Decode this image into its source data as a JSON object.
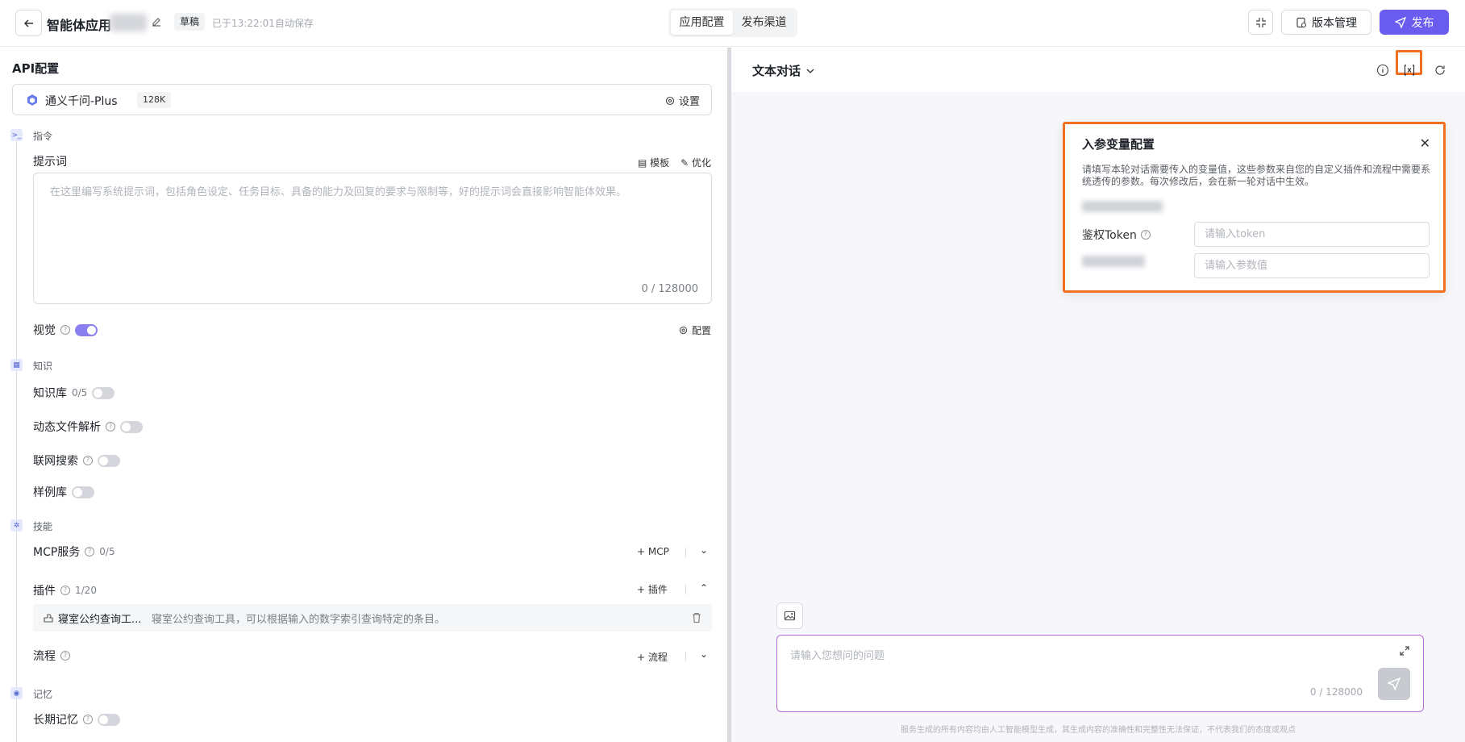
{
  "header": {
    "title": "智能体应用",
    "draft_badge": "草稿",
    "autosave": "已于13:22:01自动保存",
    "tabs": [
      "应用配置",
      "发布渠道"
    ],
    "version_btn": "版本管理",
    "publish_btn": "发布",
    "accent": "#6b5cf0"
  },
  "left": {
    "api_title": "API配置",
    "model": {
      "name": "通义千问-Plus",
      "context": "128K",
      "settings": "设置"
    },
    "instructions": {
      "group": "指令",
      "prompt_label": "提示词",
      "template": "模板",
      "optimize": "优化",
      "placeholder": "在这里编写系统提示词，包括角色设定、任务目标、具备的能力及回复的要求与限制等，好的提示词会直接影响智能体效果。",
      "counter": "0 / 128000",
      "vision_label": "视觉",
      "vision_config": "配置"
    },
    "knowledge": {
      "group": "知识",
      "kb_label": "知识库",
      "kb_count": "0/5",
      "dynamic_file": "动态文件解析",
      "web_search": "联网搜索",
      "samples": "样例库"
    },
    "skills": {
      "group": "技能",
      "mcp_label": "MCP服务",
      "mcp_count": "0/5",
      "mcp_add": "+ MCP",
      "plugin_label": "插件",
      "plugin_count": "1/20",
      "plugin_add": "+ 插件",
      "plugin_item_name": "寝室公约查询工...",
      "plugin_item_desc": "寝室公约查询工具，可以根据输入的数字索引查询特定的条目。",
      "flow_label": "流程",
      "flow_add": "+ 流程"
    },
    "memory": {
      "group": "记忆",
      "long_term": "长期记忆"
    }
  },
  "right": {
    "mode": "文本对话",
    "panel": {
      "title": "入参变量配置",
      "desc": "请填写本轮对话需要传入的变量值，这些参数来自您的自定义插件和流程中需要系统透传的参数。每次修改后，会在新一轮对话中生效。",
      "token_label": "鉴权Token",
      "token_placeholder": "请输入token",
      "param_placeholder": "请输入参数值"
    },
    "chat_placeholder": "请输入您想问的问题",
    "chat_counter": "0 / 128000",
    "disclaimer": "服务生成的所有内容均由人工智能模型生成，其生成内容的准确性和完整性无法保证，不代表我们的态度或观点",
    "highlight_color": "#ee7020"
  }
}
